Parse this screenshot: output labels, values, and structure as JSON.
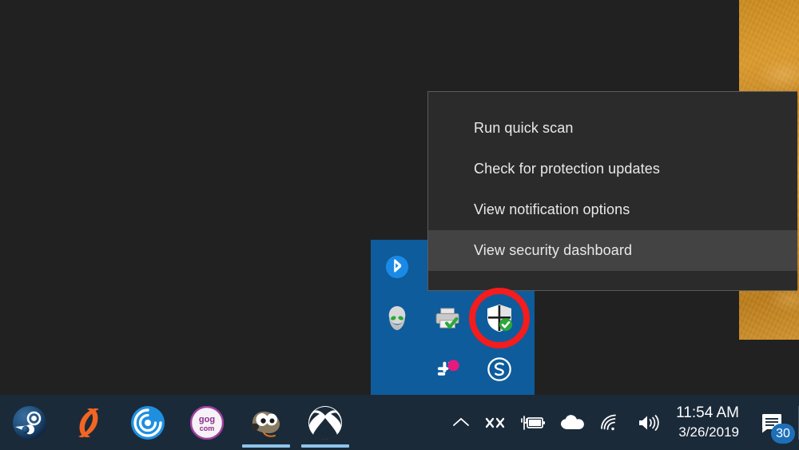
{
  "desktop": {
    "background_color": "#212121",
    "wallpaper_color": "#c78b26"
  },
  "context_menu": {
    "name": "windows-defender-tray-context-menu",
    "background_color": "#2b2b2b",
    "highlight_color": "#434343",
    "items": [
      {
        "label": "Run quick scan",
        "highlighted": false
      },
      {
        "label": "Check for protection updates",
        "highlighted": false
      },
      {
        "label": "View notification options",
        "highlighted": false
      },
      {
        "label": "View security dashboard",
        "highlighted": true
      }
    ]
  },
  "tray_flyout": {
    "name": "hidden-icons-flyout",
    "background_color": "#0e5c9c",
    "icons": [
      {
        "name": "bluetooth-icon",
        "label": "Bluetooth",
        "col": 0,
        "row": 0
      },
      {
        "name": "alienware-icon",
        "label": "Alienware Command Center",
        "col": 0,
        "row": 1
      },
      {
        "name": "printer-icon",
        "label": "Printer",
        "col": 1,
        "row": 1
      },
      {
        "name": "windows-defender-shield-icon",
        "label": "Windows Defender Security Center",
        "col": 2,
        "row": 1
      },
      {
        "name": "slack-icon",
        "label": "Slack",
        "col": 1,
        "row": 2
      },
      {
        "name": "skype-icon",
        "label": "Skype",
        "col": 2,
        "row": 2
      }
    ]
  },
  "annotation": {
    "name": "red-highlight-circle",
    "color": "#f41c1c",
    "target": "windows-defender-shield-icon"
  },
  "taskbar": {
    "background_color": "#1b2a39",
    "accent_color": "#8ec4ea",
    "pinned_apps": [
      {
        "name": "steam-icon",
        "label": "Steam",
        "active": false
      },
      {
        "name": "origin-icon",
        "label": "Origin",
        "active": false
      },
      {
        "name": "uplay-icon",
        "label": "Uplay",
        "active": false
      },
      {
        "name": "gog-icon",
        "label": "GOG.com",
        "active": false
      },
      {
        "name": "gimp-icon",
        "label": "GIMP",
        "active": true
      },
      {
        "name": "xbox-icon",
        "label": "Xbox",
        "active": true
      }
    ],
    "tray": [
      {
        "name": "show-hidden-icons-chevron",
        "label": "Show hidden icons"
      },
      {
        "name": "xsplit-icon",
        "label": "XX"
      },
      {
        "name": "battery-charging-icon",
        "label": "Battery charging"
      },
      {
        "name": "onedrive-cloud-icon",
        "label": "OneDrive"
      },
      {
        "name": "wifi-icon",
        "label": "Network"
      },
      {
        "name": "volume-icon",
        "label": "Volume"
      }
    ],
    "clock": {
      "time": "11:54 AM",
      "date": "3/26/2019"
    },
    "action_center": {
      "name": "action-center-icon",
      "badge": "30"
    }
  }
}
